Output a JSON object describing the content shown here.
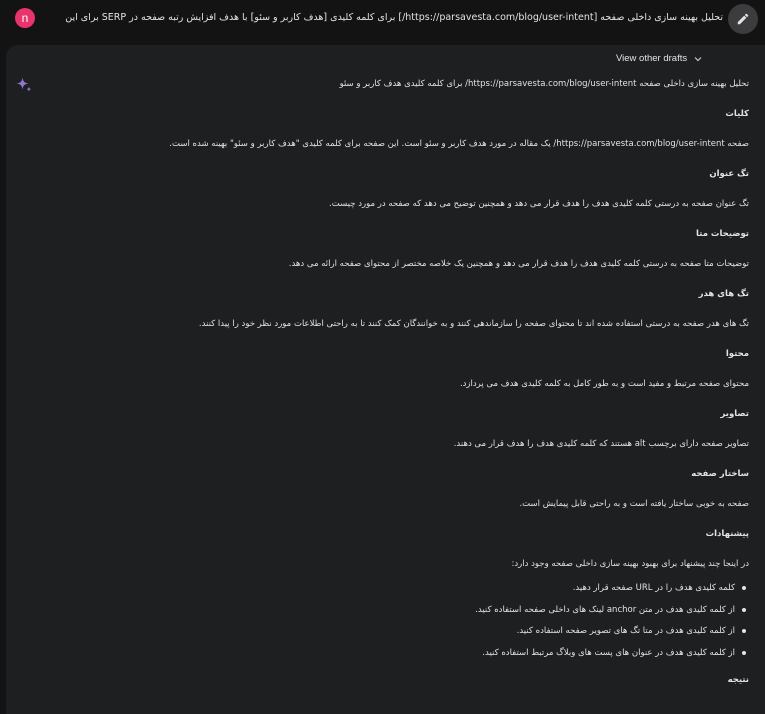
{
  "user": {
    "avatar_letter": "n"
  },
  "prompt": {
    "text": "تحلیل بهینه سازی داخلی صفحه [https://parsavesta.com/blog/user-intent/] برای کلمه کلیدی [هدف کاربر و سئو] با هدف افزایش رتبه صفحه در SERP برای این کلمه کلیدی."
  },
  "toolbar": {
    "view_drafts_label": "View other drafts"
  },
  "icons": {
    "edit": "pencil-icon",
    "drafts": "chevron-down-icon",
    "model": "sparkle-icon"
  },
  "colors": {
    "avatar": "#e8336d",
    "spark_blue": "#4b8df8",
    "spark_pink": "#d96570",
    "card_bg": "#1e1f20",
    "page_bg": "#131314"
  },
  "response": {
    "paragraphs": [
      {
        "text": "تحلیل بهینه سازی داخلی صفحه https://parsavesta.com/blog/user-intent/ برای کلمه کلیدی هدف کاربر و سئو",
        "kind": "body"
      },
      {
        "text": "کلیات",
        "kind": "head"
      },
      {
        "text": "صفحه https://parsavesta.com/blog/user-intent/ یک مقاله در مورد هدف کاربر و سئو است. این صفحه برای کلمه کلیدی \"هدف کاربر و سئو\" بهینه شده است.",
        "kind": "body"
      },
      {
        "text": "تگ عنوان",
        "kind": "head"
      },
      {
        "text": "تگ عنوان صفحه به درستی کلمه کلیدی هدف را هدف قرار می دهد و همچنین توضیح می دهد که صفحه در مورد چیست.",
        "kind": "body"
      },
      {
        "text": "توضیحات متا",
        "kind": "head"
      },
      {
        "text": "توضیحات متا صفحه به درستی کلمه کلیدی هدف را هدف قرار می دهد و همچنین یک خلاصه مختصر از محتوای صفحه ارائه می دهد.",
        "kind": "body"
      },
      {
        "text": "تگ های هدر",
        "kind": "head"
      },
      {
        "text": "تگ های هدر صفحه به درستی استفاده شده اند تا محتوای صفحه را سازماندهی کنند و به خوانندگان کمک کنند تا به راحتی اطلاعات مورد نظر خود را پیدا کنند.",
        "kind": "body"
      },
      {
        "text": "محتوا",
        "kind": "head"
      },
      {
        "text": "محتوای صفحه مرتبط و مفید است و به طور کامل به کلمه کلیدی هدف می پردازد.",
        "kind": "body"
      },
      {
        "text": "تصاویر",
        "kind": "head"
      },
      {
        "text": "تصاویر صفحه دارای برچسب alt هستند که کلمه کلیدی هدف را هدف قرار می دهند.",
        "kind": "body"
      },
      {
        "text": "ساختار صفحه",
        "kind": "head"
      },
      {
        "text": "صفحه به خوبی ساختار یافته است و به راحتی قابل پیمایش است.",
        "kind": "body"
      },
      {
        "text": "پیشنهادات",
        "kind": "head"
      },
      {
        "text": "در اینجا چند پیشنهاد برای بهبود بهینه سازی داخلی صفحه وجود دارد:",
        "kind": "body"
      }
    ],
    "bullets": [
      "کلمه کلیدی هدف را در URL صفحه قرار دهید.",
      "از کلمه کلیدی هدف در متن anchor لینک های داخلی صفحه استفاده کنید.",
      "از کلمه کلیدی هدف در متا تگ های تصویر صفحه استفاده کنید.",
      "از کلمه کلیدی هدف در عنوان های پست های وبلاگ مرتبط استفاده کنید."
    ],
    "conclusion": "نتیجه"
  }
}
